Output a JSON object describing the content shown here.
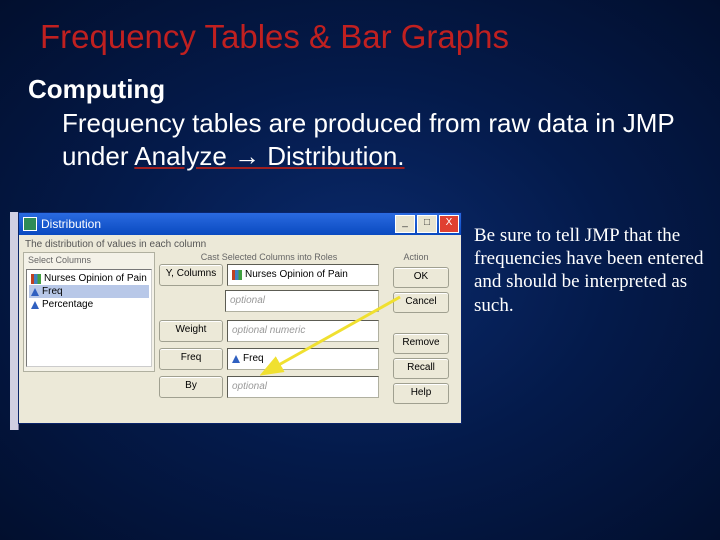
{
  "title": "Frequency Tables & Bar Graphs",
  "subtitle": "Computing",
  "body_text_1": "Frequency tables are produced from raw data in JMP under ",
  "body_text_2": "Analyze → Distribution.",
  "side_note": "Be sure to tell JMP that the frequencies have been entered and should be interpreted as such.",
  "dialog": {
    "title": "Distribution",
    "subtitle": "The distribution of values in each column",
    "select_columns_label": "Select Columns",
    "cast_label": "Cast Selected Columns into Roles",
    "action_label": "Action",
    "columns": {
      "c1": "Nurses Opinion of Pain",
      "c2": "Freq",
      "c3": "Percentage"
    },
    "role_buttons": {
      "ycols": "Y, Columns",
      "weight": "Weight",
      "freq": "Freq",
      "by": "By"
    },
    "field_values": {
      "ycols": "Nurses Opinion of Pain",
      "weight": "optional numeric",
      "freq": "Freq",
      "by": "optional"
    },
    "action_buttons": {
      "ok": "OK",
      "cancel": "Cancel",
      "remove": "Remove",
      "recall": "Recall",
      "help": "Help"
    },
    "win_minimize": "_",
    "win_maximize": "□",
    "win_close": "X"
  }
}
